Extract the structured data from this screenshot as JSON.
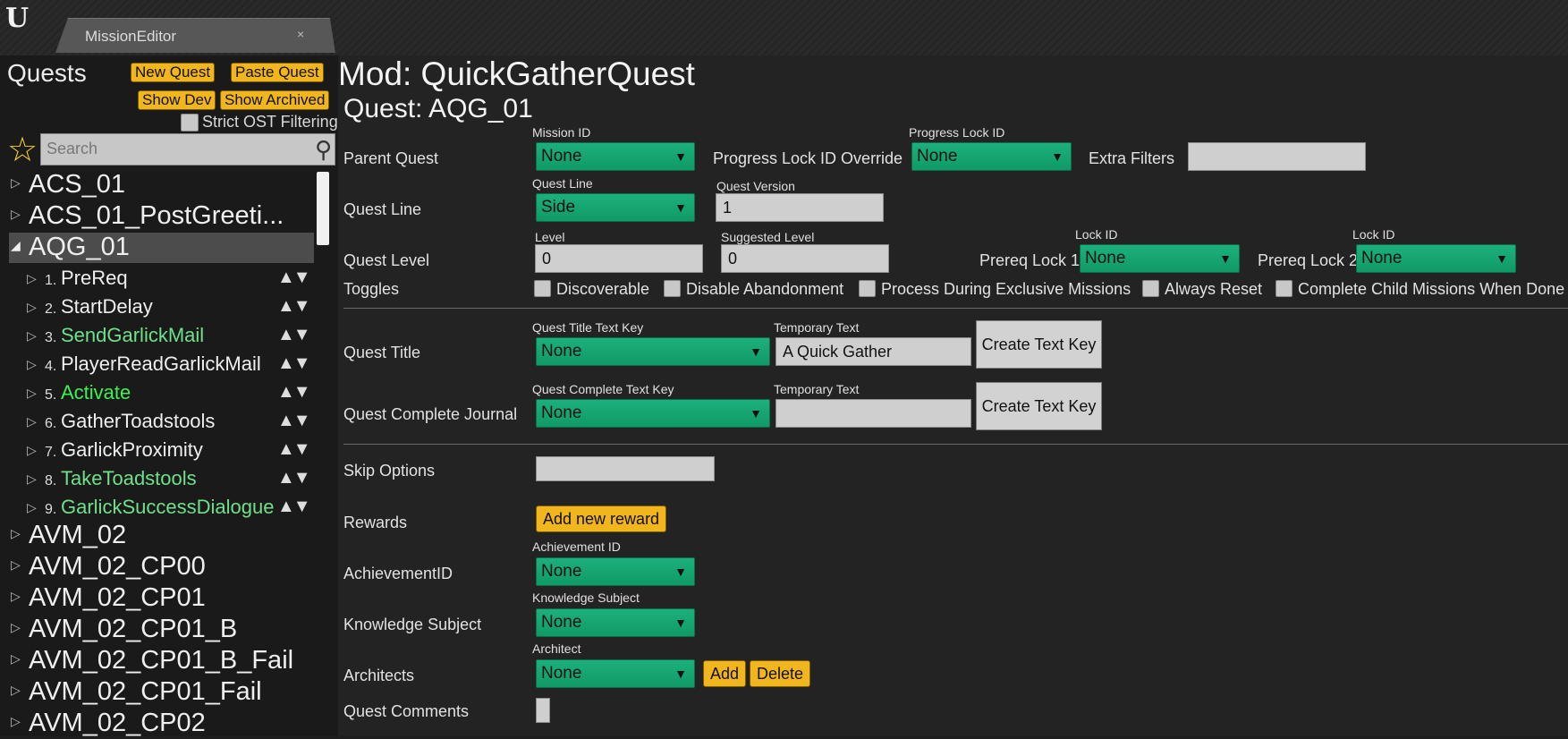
{
  "tab": {
    "label": "MissionEditor",
    "close": "×"
  },
  "sidebar": {
    "title": "Quests",
    "new_quest": "New Quest",
    "paste_quest": "Paste Quest",
    "show_dev": "Show Dev",
    "show_archived": "Show Archived",
    "strict_filter": "Strict OST Filtering",
    "search_placeholder": "Search",
    "quests": [
      "ACS_01",
      "ACS_01_PostGreeti...",
      "AQG_01",
      "AVM_02",
      "AVM_02_CP00",
      "AVM_02_CP01",
      "AVM_02_CP01_B",
      "AVM_02_CP01_B_Fail",
      "AVM_02_CP01_Fail",
      "AVM_02_CP02"
    ],
    "children": [
      {
        "num": "1.",
        "label": "PreReq",
        "color": "#efefef"
      },
      {
        "num": "2.",
        "label": "StartDelay",
        "color": "#efefef"
      },
      {
        "num": "3.",
        "label": "SendGarlickMail",
        "color": "#6fe08a"
      },
      {
        "num": "4.",
        "label": "PlayerReadGarlickMail",
        "color": "#efefef"
      },
      {
        "num": "5.",
        "label": "Activate",
        "color": "#3ff051"
      },
      {
        "num": "6.",
        "label": "GatherToadstools",
        "color": "#efefef"
      },
      {
        "num": "7.",
        "label": "GarlickProximity",
        "color": "#efefef"
      },
      {
        "num": "8.",
        "label": "TakeToadstools",
        "color": "#6fe08a"
      },
      {
        "num": "9.",
        "label": "GarlickSuccessDialogue",
        "color": "#6fe08a"
      }
    ],
    "updown": "▲▼"
  },
  "main": {
    "mod_title": "Mod: QuickGatherQuest",
    "quest_title": "Quest: AQG_01",
    "parent_quest": "Parent Quest",
    "mission_id": "Mission ID",
    "mission_id_value": "None",
    "progress_lock_override": "Progress Lock ID Override",
    "progress_lock_id": "Progress Lock ID",
    "progress_lock_value": "None",
    "extra_filters": "Extra Filters",
    "quest_line": "Quest Line",
    "quest_line_caption": "Quest Line",
    "quest_line_value": "Side",
    "quest_version": "Quest Version",
    "quest_version_value": "1",
    "quest_level": "Quest Level",
    "level": "Level",
    "level_value": "0",
    "suggested_level": "Suggested Level",
    "suggested_level_value": "0",
    "prereq1": "Prereq Lock 1",
    "prereq2": "Prereq Lock 2",
    "lock_id": "Lock ID",
    "lock1_value": "None",
    "lock2_value": "None",
    "toggles": "Toggles",
    "toggle_items": [
      "Discoverable",
      "Disable Abandonment",
      "Process During Exclusive Missions",
      "Always Reset",
      "Complete Child Missions When Done"
    ],
    "quest_title_row": "Quest Title",
    "quest_title_text_key": "Quest Title Text Key",
    "quest_title_key_value": "None",
    "temporary_text": "Temporary Text",
    "temporary_text_value": "A Quick Gather",
    "create_text_key": "Create Text Key",
    "quest_complete_journal": "Quest Complete Journal",
    "quest_complete_text_key": "Quest Complete Text Key",
    "quest_complete_key_value": "None",
    "temporary_text2": "Temporary Text",
    "temporary_text2_value": "",
    "skip_options": "Skip Options",
    "rewards": "Rewards",
    "add_new_reward": "Add new reward",
    "achievement_id": "AchievementID",
    "achievement_caption": "Achievement ID",
    "achievement_value": "None",
    "knowledge_subject": "Knowledge Subject",
    "knowledge_caption": "Knowledge Subject",
    "knowledge_value": "None",
    "architects": "Architects",
    "architect_caption": "Architect",
    "architect_value": "None",
    "add": "Add",
    "delete": "Delete",
    "quest_comments": "Quest Comments"
  },
  "colors": {
    "accent_yellow": "#f1b51e",
    "dropdown_green": "#1db07c"
  }
}
